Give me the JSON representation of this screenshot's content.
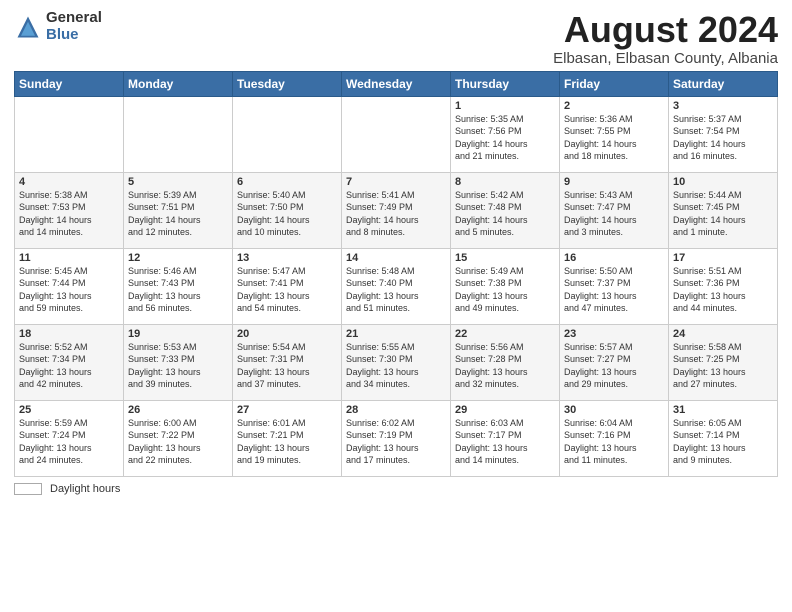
{
  "logo": {
    "general": "General",
    "blue": "Blue"
  },
  "title": "August 2024",
  "subtitle": "Elbasan, Elbasan County, Albania",
  "calendar": {
    "headers": [
      "Sunday",
      "Monday",
      "Tuesday",
      "Wednesday",
      "Thursday",
      "Friday",
      "Saturday"
    ],
    "weeks": [
      [
        {
          "day": "",
          "info": ""
        },
        {
          "day": "",
          "info": ""
        },
        {
          "day": "",
          "info": ""
        },
        {
          "day": "",
          "info": ""
        },
        {
          "day": "1",
          "info": "Sunrise: 5:35 AM\nSunset: 7:56 PM\nDaylight: 14 hours\nand 21 minutes."
        },
        {
          "day": "2",
          "info": "Sunrise: 5:36 AM\nSunset: 7:55 PM\nDaylight: 14 hours\nand 18 minutes."
        },
        {
          "day": "3",
          "info": "Sunrise: 5:37 AM\nSunset: 7:54 PM\nDaylight: 14 hours\nand 16 minutes."
        }
      ],
      [
        {
          "day": "4",
          "info": "Sunrise: 5:38 AM\nSunset: 7:53 PM\nDaylight: 14 hours\nand 14 minutes."
        },
        {
          "day": "5",
          "info": "Sunrise: 5:39 AM\nSunset: 7:51 PM\nDaylight: 14 hours\nand 12 minutes."
        },
        {
          "day": "6",
          "info": "Sunrise: 5:40 AM\nSunset: 7:50 PM\nDaylight: 14 hours\nand 10 minutes."
        },
        {
          "day": "7",
          "info": "Sunrise: 5:41 AM\nSunset: 7:49 PM\nDaylight: 14 hours\nand 8 minutes."
        },
        {
          "day": "8",
          "info": "Sunrise: 5:42 AM\nSunset: 7:48 PM\nDaylight: 14 hours\nand 5 minutes."
        },
        {
          "day": "9",
          "info": "Sunrise: 5:43 AM\nSunset: 7:47 PM\nDaylight: 14 hours\nand 3 minutes."
        },
        {
          "day": "10",
          "info": "Sunrise: 5:44 AM\nSunset: 7:45 PM\nDaylight: 14 hours\nand 1 minute."
        }
      ],
      [
        {
          "day": "11",
          "info": "Sunrise: 5:45 AM\nSunset: 7:44 PM\nDaylight: 13 hours\nand 59 minutes."
        },
        {
          "day": "12",
          "info": "Sunrise: 5:46 AM\nSunset: 7:43 PM\nDaylight: 13 hours\nand 56 minutes."
        },
        {
          "day": "13",
          "info": "Sunrise: 5:47 AM\nSunset: 7:41 PM\nDaylight: 13 hours\nand 54 minutes."
        },
        {
          "day": "14",
          "info": "Sunrise: 5:48 AM\nSunset: 7:40 PM\nDaylight: 13 hours\nand 51 minutes."
        },
        {
          "day": "15",
          "info": "Sunrise: 5:49 AM\nSunset: 7:38 PM\nDaylight: 13 hours\nand 49 minutes."
        },
        {
          "day": "16",
          "info": "Sunrise: 5:50 AM\nSunset: 7:37 PM\nDaylight: 13 hours\nand 47 minutes."
        },
        {
          "day": "17",
          "info": "Sunrise: 5:51 AM\nSunset: 7:36 PM\nDaylight: 13 hours\nand 44 minutes."
        }
      ],
      [
        {
          "day": "18",
          "info": "Sunrise: 5:52 AM\nSunset: 7:34 PM\nDaylight: 13 hours\nand 42 minutes."
        },
        {
          "day": "19",
          "info": "Sunrise: 5:53 AM\nSunset: 7:33 PM\nDaylight: 13 hours\nand 39 minutes."
        },
        {
          "day": "20",
          "info": "Sunrise: 5:54 AM\nSunset: 7:31 PM\nDaylight: 13 hours\nand 37 minutes."
        },
        {
          "day": "21",
          "info": "Sunrise: 5:55 AM\nSunset: 7:30 PM\nDaylight: 13 hours\nand 34 minutes."
        },
        {
          "day": "22",
          "info": "Sunrise: 5:56 AM\nSunset: 7:28 PM\nDaylight: 13 hours\nand 32 minutes."
        },
        {
          "day": "23",
          "info": "Sunrise: 5:57 AM\nSunset: 7:27 PM\nDaylight: 13 hours\nand 29 minutes."
        },
        {
          "day": "24",
          "info": "Sunrise: 5:58 AM\nSunset: 7:25 PM\nDaylight: 13 hours\nand 27 minutes."
        }
      ],
      [
        {
          "day": "25",
          "info": "Sunrise: 5:59 AM\nSunset: 7:24 PM\nDaylight: 13 hours\nand 24 minutes."
        },
        {
          "day": "26",
          "info": "Sunrise: 6:00 AM\nSunset: 7:22 PM\nDaylight: 13 hours\nand 22 minutes."
        },
        {
          "day": "27",
          "info": "Sunrise: 6:01 AM\nSunset: 7:21 PM\nDaylight: 13 hours\nand 19 minutes."
        },
        {
          "day": "28",
          "info": "Sunrise: 6:02 AM\nSunset: 7:19 PM\nDaylight: 13 hours\nand 17 minutes."
        },
        {
          "day": "29",
          "info": "Sunrise: 6:03 AM\nSunset: 7:17 PM\nDaylight: 13 hours\nand 14 minutes."
        },
        {
          "day": "30",
          "info": "Sunrise: 6:04 AM\nSunset: 7:16 PM\nDaylight: 13 hours\nand 11 minutes."
        },
        {
          "day": "31",
          "info": "Sunrise: 6:05 AM\nSunset: 7:14 PM\nDaylight: 13 hours\nand 9 minutes."
        }
      ]
    ]
  },
  "footer": {
    "swatch_label": "Daylight hours"
  }
}
